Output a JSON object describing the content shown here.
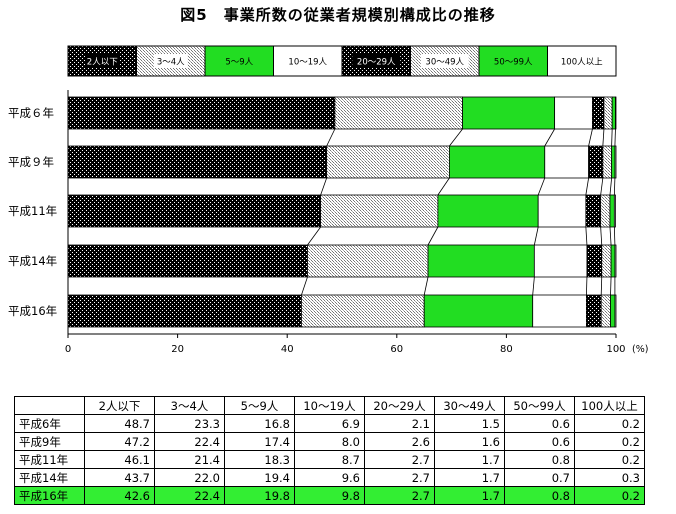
{
  "title": "図5　事業所数の従業者規模別構成比の推移",
  "legend_labels": [
    "2人以下",
    "3～4人",
    "5～9人",
    "10～19人",
    "20～29人",
    "30～49人",
    "50～99人",
    "100人以上"
  ],
  "chart_data": {
    "type": "bar",
    "orientation": "horizontal",
    "stacked": true,
    "title": "図5　事業所数の従業者規模別構成比の推移",
    "xlabel": "",
    "unit": "(%)",
    "xlim": [
      0,
      100
    ],
    "x_ticks": [
      0,
      20,
      40,
      60,
      80,
      100
    ],
    "categories": [
      "平成６年",
      "平成９年",
      "平成11年",
      "平成14年",
      "平成16年"
    ],
    "series": [
      {
        "name": "2人以下",
        "values": [
          48.7,
          47.2,
          46.1,
          43.7,
          42.6
        ]
      },
      {
        "name": "3～4人",
        "values": [
          23.3,
          22.4,
          21.4,
          22.0,
          22.4
        ]
      },
      {
        "name": "5～9人",
        "values": [
          16.8,
          17.4,
          18.3,
          19.4,
          19.8
        ]
      },
      {
        "name": "10～19人",
        "values": [
          6.9,
          8.0,
          8.7,
          9.6,
          9.8
        ]
      },
      {
        "name": "20～29人",
        "values": [
          2.1,
          2.6,
          2.7,
          2.7,
          2.7
        ]
      },
      {
        "name": "30～49人",
        "values": [
          1.5,
          1.6,
          1.7,
          1.7,
          1.7
        ]
      },
      {
        "name": "50～99人",
        "values": [
          0.6,
          0.6,
          0.8,
          0.7,
          0.8
        ]
      },
      {
        "name": "100人以上",
        "values": [
          0.2,
          0.2,
          0.2,
          0.3,
          0.2
        ]
      }
    ],
    "legend_position": "top",
    "grid": false
  },
  "table": {
    "headers": [
      "",
      "2人以下",
      "3～4人",
      "5～9人",
      "10～19人",
      "20～29人",
      "30～49人",
      "50～99人",
      "100人以上"
    ],
    "rows": [
      {
        "label": "平成6年",
        "values": [
          "48.7",
          "23.3",
          "16.8",
          "6.9",
          "2.1",
          "1.5",
          "0.6",
          "0.2"
        ]
      },
      {
        "label": "平成9年",
        "values": [
          "47.2",
          "22.4",
          "17.4",
          "8.0",
          "2.6",
          "1.6",
          "0.6",
          "0.2"
        ]
      },
      {
        "label": "平成11年",
        "values": [
          "46.1",
          "21.4",
          "18.3",
          "8.7",
          "2.7",
          "1.7",
          "0.8",
          "0.2"
        ]
      },
      {
        "label": "平成14年",
        "values": [
          "43.7",
          "22.0",
          "19.4",
          "9.6",
          "2.7",
          "1.7",
          "0.7",
          "0.3"
        ]
      },
      {
        "label": "平成16年",
        "values": [
          "42.6",
          "22.4",
          "19.8",
          "9.8",
          "2.7",
          "1.7",
          "0.8",
          "0.2"
        ]
      }
    ],
    "highlight_row": 4,
    "highlight_color": "#33ee33"
  },
  "colors": {
    "s0_bg": "#000000",
    "s0_fg": "#ffffff",
    "s1_bg": "#ffffff",
    "s1_fg": "#888888",
    "s2": "#22dd22",
    "s3": "#ffffff",
    "s4_bg": "#000000",
    "s4_fg": "#ffffff",
    "s5_bg": "#ffffff",
    "s5_fg": "#888888",
    "s6": "#22dd22",
    "s7": "#ffffff"
  }
}
